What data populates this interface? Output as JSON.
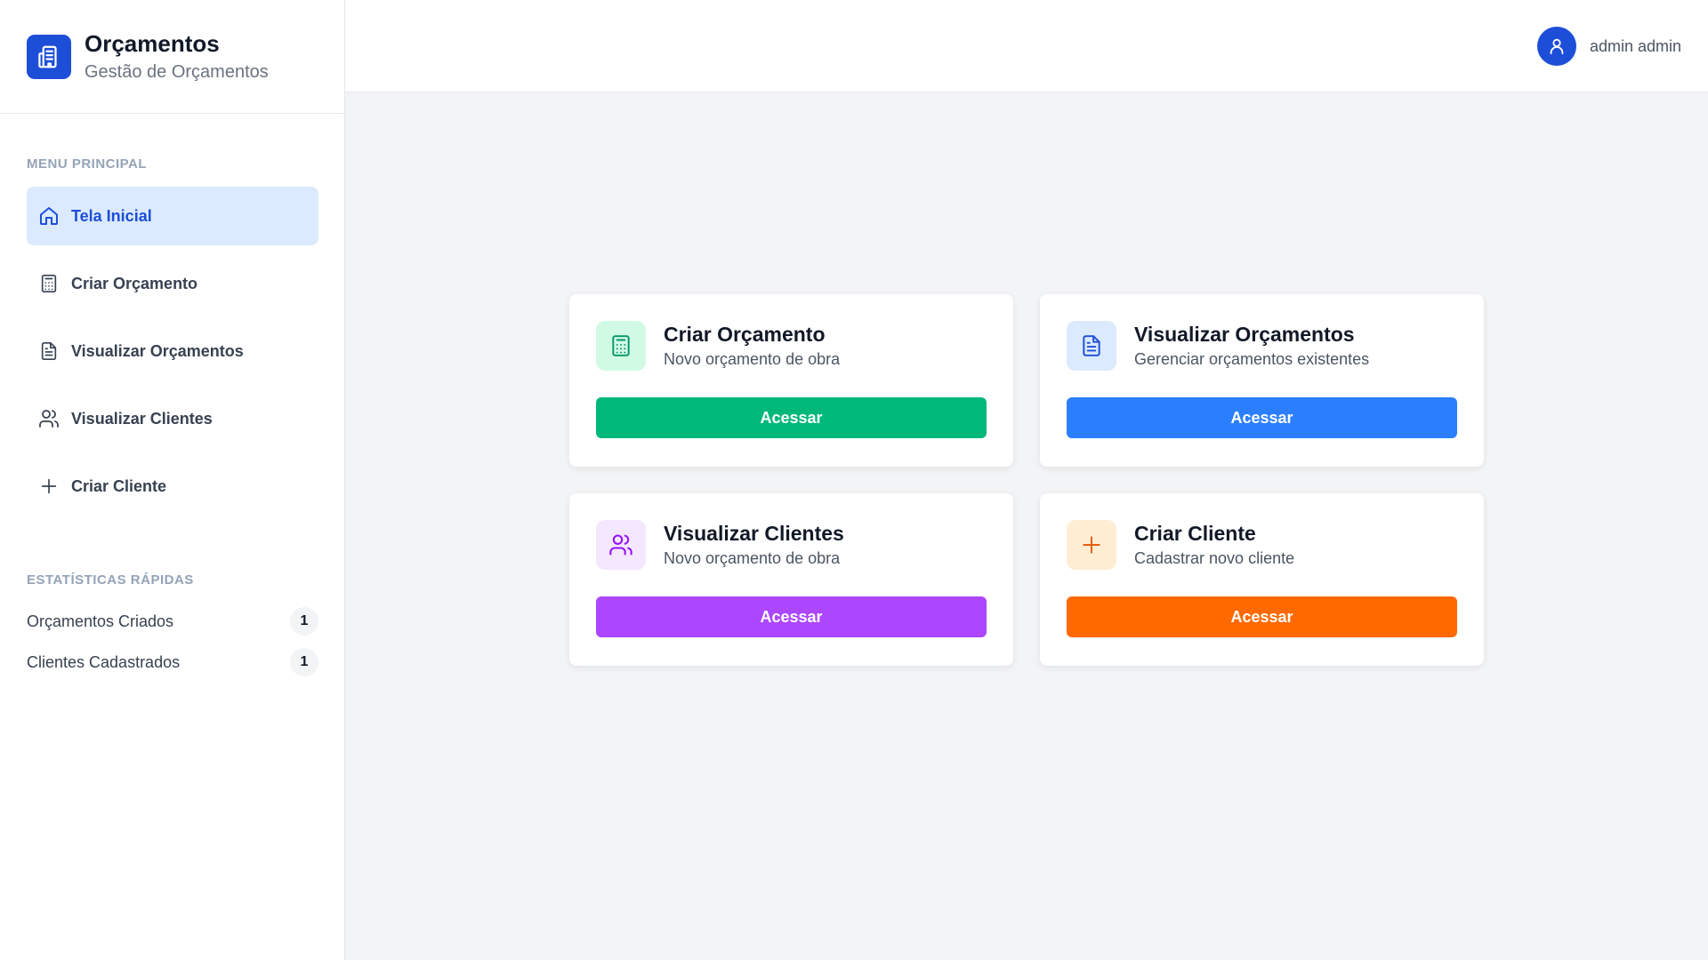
{
  "sidebar": {
    "brand": {
      "title": "Orçamentos",
      "subtitle": "Gestão de Orçamentos",
      "icon": "building-icon",
      "color": "#1d4ed8"
    },
    "menu_label": "MENU PRINCIPAL",
    "items": [
      {
        "label": "Tela Inicial",
        "icon": "home-icon",
        "active": true
      },
      {
        "label": "Criar Orçamento",
        "icon": "calculator-icon",
        "active": false
      },
      {
        "label": "Visualizar Orçamentos",
        "icon": "file-text-icon",
        "active": false
      },
      {
        "label": "Visualizar Clientes",
        "icon": "users-icon",
        "active": false
      },
      {
        "label": "Criar Cliente",
        "icon": "plus-icon",
        "active": false
      }
    ],
    "stats_label": "ESTATÍSTICAS RÁPIDAS",
    "stats": [
      {
        "label": "Orçamentos Criados",
        "value": "1"
      },
      {
        "label": "Clientes Cadastrados",
        "value": "1"
      }
    ]
  },
  "header": {
    "user_name": "admin admin",
    "avatar_icon": "user-icon"
  },
  "cards": [
    {
      "title": "Criar Orçamento",
      "subtitle": "Novo orçamento de obra",
      "button": "Acessar",
      "icon": "calculator-icon",
      "accent": "#00b87a",
      "icon_bg": "#d1fae5",
      "icon_color": "#059669"
    },
    {
      "title": "Visualizar Orçamentos",
      "subtitle": "Gerenciar orçamentos existentes",
      "button": "Acessar",
      "icon": "file-text-icon",
      "accent": "#2b7fff",
      "icon_bg": "#dbeafe",
      "icon_color": "#1d4ed8"
    },
    {
      "title": "Visualizar Clientes",
      "subtitle": "Novo orçamento de obra",
      "button": "Acessar",
      "icon": "users-icon",
      "accent": "#ad46ff",
      "icon_bg": "#f3e8ff",
      "icon_color": "#9810fa"
    },
    {
      "title": "Criar Cliente",
      "subtitle": "Cadastrar novo cliente",
      "button": "Acessar",
      "icon": "plus-icon",
      "accent": "#ff6900",
      "icon_bg": "#ffedd4",
      "icon_color": "#e85d04"
    }
  ]
}
